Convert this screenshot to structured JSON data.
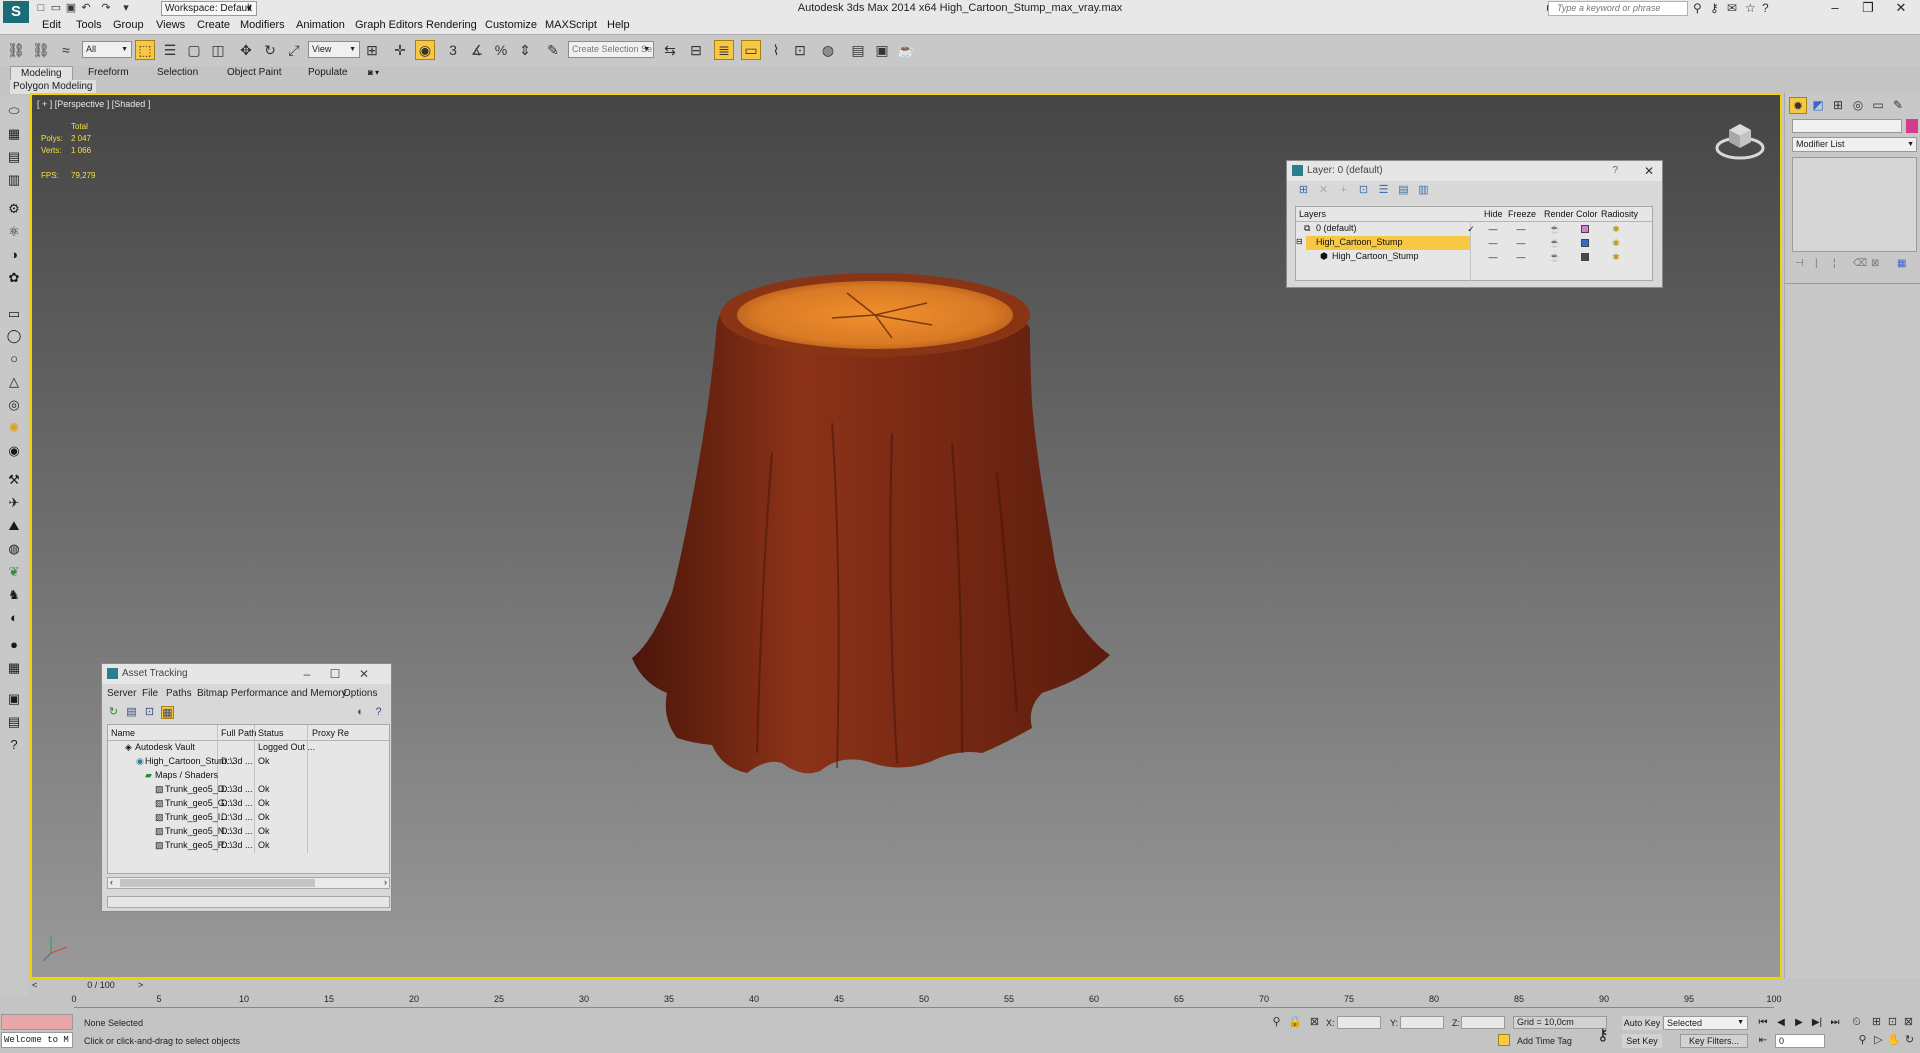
{
  "titlebar": {
    "title": "Autodesk 3ds Max  2014 x64     High_Cartoon_Stump_max_vray.max",
    "workspace": "Workspace: Default",
    "help_search_placeholder": "Type a keyword or phrase"
  },
  "menu": [
    "Edit",
    "Tools",
    "Group",
    "Views",
    "Create",
    "Modifiers",
    "Animation",
    "Graph Editors",
    "Rendering",
    "Customize",
    "MAXScript",
    "Help"
  ],
  "toolbar": {
    "filter_value": "All",
    "reference_coord": "View",
    "named_selection_placeholder": "Create Selection Se"
  },
  "ribbon": {
    "tabs": [
      "Modeling",
      "Freeform",
      "Selection",
      "Object Paint",
      "Populate"
    ],
    "active_tab": "Modeling",
    "sub_label": "Polygon Modeling"
  },
  "viewport": {
    "label": "[ + ] [Perspective ] [Shaded ]",
    "stats_total": "Total",
    "polys_label": "Polys:",
    "polys_value": "2 047",
    "verts_label": "Verts:",
    "verts_value": "1 066",
    "fps_label": "FPS:",
    "fps_value": "79,279"
  },
  "layer_dialog": {
    "title": "Layer: 0 (default)",
    "help": "?",
    "columns": [
      "Layers",
      "Hide",
      "Freeze",
      "Render",
      "Color",
      "Radiosity"
    ],
    "rows": [
      {
        "name": "0 (default)",
        "color": "#d77fd5",
        "current": true,
        "selected": false,
        "indent": 0
      },
      {
        "name": "High_Cartoon_Stump",
        "color": "#3c6cc9",
        "current": false,
        "selected": true,
        "indent": 0
      },
      {
        "name": "High_Cartoon_Stump",
        "color": "#4a4a4a",
        "current": false,
        "selected": false,
        "indent": 1
      }
    ]
  },
  "asset_dialog": {
    "title": "Asset Tracking",
    "menu": [
      "Server",
      "File",
      "Paths",
      "Bitmap Performance and Memory",
      "Options"
    ],
    "columns": [
      "Name",
      "Full Path",
      "Status",
      "Proxy Re"
    ],
    "rows": [
      {
        "name": "Autodesk Vault",
        "path": "",
        "status": "Logged Out ...",
        "indent": 1
      },
      {
        "name": "High_Cartoon_Stum...",
        "path": "D:\\3d ...",
        "status": "Ok",
        "indent": 2
      },
      {
        "name": "Maps / Shaders",
        "path": "",
        "status": "",
        "indent": 3
      },
      {
        "name": "Trunk_geo5_D...",
        "path": "D:\\3d ...",
        "status": "Ok",
        "indent": 4
      },
      {
        "name": "Trunk_geo5_G...",
        "path": "D:\\3d ...",
        "status": "Ok",
        "indent": 4
      },
      {
        "name": "Trunk_geo5_I...",
        "path": "D:\\3d ...",
        "status": "Ok",
        "indent": 4
      },
      {
        "name": "Trunk_geo5_N...",
        "path": "D:\\3d ...",
        "status": "Ok",
        "indent": 4
      },
      {
        "name": "Trunk_geo5_R...",
        "path": "D:\\3d ...",
        "status": "Ok",
        "indent": 4
      }
    ]
  },
  "command_panel": {
    "modifier_list": "Modifier List",
    "object_color": "#d33c8c"
  },
  "timeline": {
    "frame_label": "0 / 100",
    "ticks": [
      "0",
      "5",
      "10",
      "15",
      "20",
      "25",
      "30",
      "35",
      "40",
      "45",
      "50",
      "55",
      "60",
      "65",
      "70",
      "75",
      "80",
      "85",
      "90",
      "95",
      "100"
    ]
  },
  "status": {
    "welcome": "Welcome to M",
    "selection": "None Selected",
    "prompt": "Click or click-and-drag to select objects",
    "x_label": "X:",
    "y_label": "Y:",
    "z_label": "Z:",
    "grid": "Grid = 10,0cm",
    "add_time_tag": "Add Time Tag",
    "auto_key": "Auto Key",
    "set_key": "Set Key",
    "selected_option": "Selected",
    "key_filters": "Key Filters...",
    "frame_value": "0"
  },
  "colors": {
    "viewport_border": "#f0d500",
    "active_button": "#f6c843",
    "stump_top": "#d97a25",
    "stump_bark": "#7a2a14"
  }
}
